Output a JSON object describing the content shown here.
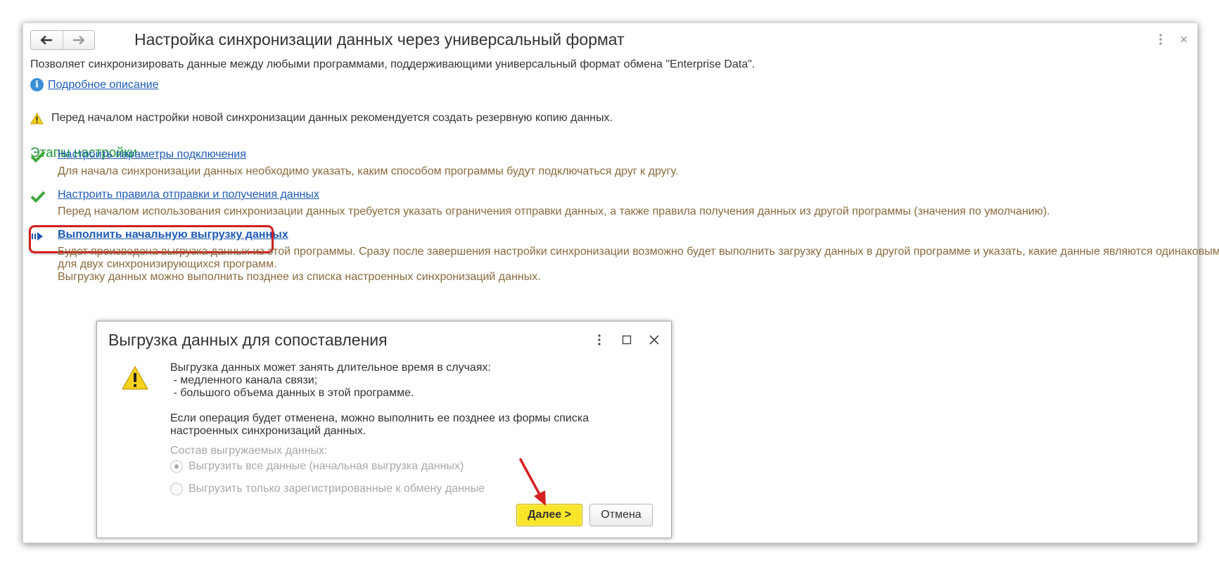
{
  "window": {
    "title": "Настройка синхронизации данных через универсальный формат",
    "description": "Позволяет синхронизировать данные между любыми программами, поддерживающими универсальный формат обмена \"Enterprise Data\".",
    "details_link": "Подробное описание",
    "warning": "Перед началом настройки новой синхронизации данных рекомендуется создать резервную копию данных."
  },
  "steps": {
    "title": "Этапы настройки",
    "items": [
      {
        "status": "done",
        "icon": "check-icon",
        "link": "Настроить параметры подключения",
        "desc": [
          "Для начала синхронизации данных необходимо указать, каким способом программы будут подключаться друг к другу."
        ]
      },
      {
        "status": "done",
        "icon": "check-icon",
        "link": "Настроить правила отправки и получения данных",
        "desc": [
          "Перед началом использования синхронизации данных требуется указать ограничения отправки данных, а также правила получения данных из другой программы (значения по умолчанию)."
        ]
      },
      {
        "status": "current",
        "icon": "current-step-arrow-icon",
        "link": "Выполнить начальную выгрузку данных",
        "desc": [
          "Будет произведена выгрузка данных из этой программы. Сразу после завершения настройки синхронизации возможно будет выполнить загрузку данных в другой программе и указать, какие данные являются одинаковыми",
          "для двух синхронизирующихся программ.",
          "Выгрузку данных можно выполнить позднее из списка настроенных синхронизаций данных."
        ]
      }
    ]
  },
  "dialog": {
    "title": "Выгрузка данных для сопоставления",
    "text1": [
      "Выгрузка данных может занять длительное время в случаях:",
      " - медленного канала связи;",
      " - большого объема данных в этой программе."
    ],
    "text2": [
      "Если операция будет отменена, можно выполнить ее позднее из формы списка",
      "настроенных синхронизаций данных."
    ],
    "group_title": "Состав выгружаемых данных:",
    "options": [
      {
        "label": "Выгрузить все данные (начальная выгрузка данных)",
        "selected": true
      },
      {
        "label": "Выгрузить только зарегистрированные к обмену данные",
        "selected": false
      }
    ],
    "next_label": "Далее >",
    "cancel_label": "Отмена"
  },
  "colors": {
    "accent_green": "#1f9a3d",
    "link_blue": "#1d5ab6",
    "desc_brown": "#8a6a3d",
    "highlight_red": "#d42020",
    "primary_button_yellow": "#f9e62a"
  }
}
